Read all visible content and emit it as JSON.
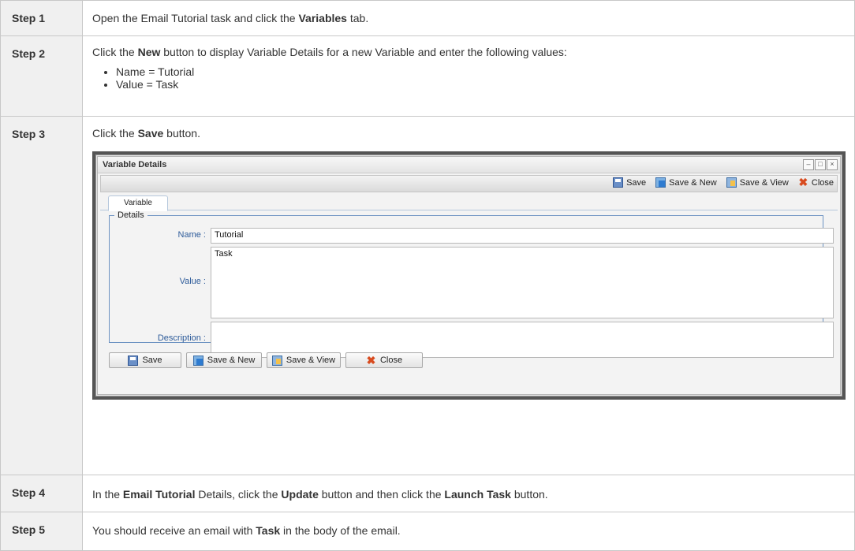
{
  "steps": [
    {
      "label": "Step 1",
      "text_pre": "Open the Email Tutorial task and click the ",
      "bold1": "Variables",
      "text_post": " tab."
    },
    {
      "label": "Step 2",
      "text_pre": "Click the ",
      "bold1": "New",
      "text_post": " button to display Variable Details for a new Variable and enter the following values:",
      "bullets": [
        "Name = Tutorial",
        "Value = Task"
      ]
    },
    {
      "label": "Step 3",
      "text_pre": "Click the ",
      "bold1": "Save",
      "text_post": " button."
    },
    {
      "label": "Step 4",
      "text_a": "In the ",
      "bold1": "Email Tutorial",
      "text_b": " Details, click the ",
      "bold2": "Update",
      "text_c": " button and then click the ",
      "bold3": "Launch Task",
      "text_d": " button."
    },
    {
      "label": "Step 5",
      "text_pre": "You should receive an email with ",
      "bold1": "Task",
      "text_post": " in the body of the email."
    }
  ],
  "dialog": {
    "title": "Variable Details",
    "window_buttons": [
      "–",
      "□",
      "×"
    ],
    "toolbar": [
      {
        "label": "Save",
        "icon": "save-icon"
      },
      {
        "label": "Save & New",
        "icon": "save-new-icon"
      },
      {
        "label": "Save & View",
        "icon": "save-view-icon"
      },
      {
        "label": "Close",
        "icon": "close-icon"
      }
    ],
    "tab": "Variable",
    "section": "Details",
    "fields": {
      "name_label": "Name :",
      "name_value": "Tutorial",
      "value_label": "Value :",
      "value_value": "Task",
      "description_label": "Description :",
      "description_value": ""
    },
    "bottom_buttons": [
      {
        "label": "Save",
        "icon": "save-icon"
      },
      {
        "label": "Save & New",
        "icon": "save-new-icon"
      },
      {
        "label": "Save & View",
        "icon": "save-view-icon"
      },
      {
        "label": "Close",
        "icon": "close-icon"
      }
    ]
  }
}
